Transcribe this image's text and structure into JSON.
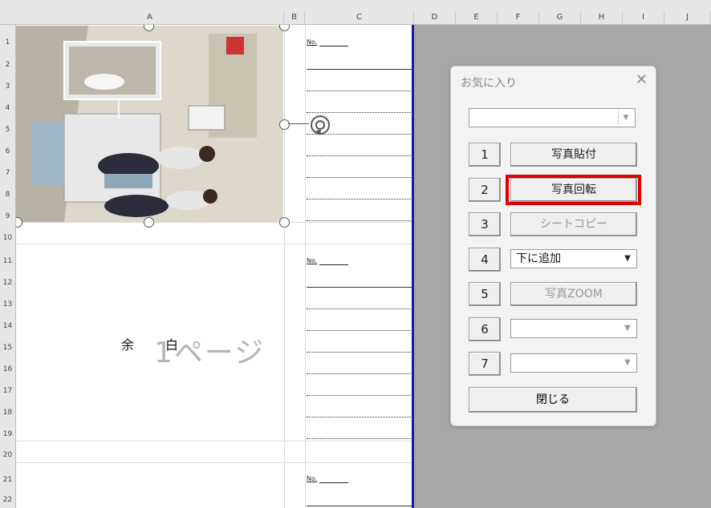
{
  "column_headers": [
    "A",
    "B",
    "C",
    "D",
    "E",
    "F",
    "G",
    "H",
    "I",
    "J"
  ],
  "row_numbers": [
    "1",
    "2",
    "3",
    "4",
    "5",
    "6",
    "7",
    "8",
    "9",
    "10",
    "11",
    "12",
    "13",
    "14",
    "15",
    "16",
    "17",
    "18",
    "19",
    "20",
    "21",
    "22"
  ],
  "sheet": {
    "no_label": "No.",
    "blank_left": "余",
    "blank_right": "白",
    "page_watermark": "1ページ"
  },
  "dialog": {
    "title": "お気に入り",
    "close_glyph": "✕",
    "buttons": [
      {
        "num": "1",
        "label": "写真貼付"
      },
      {
        "num": "2",
        "label": "写真回転"
      },
      {
        "num": "3",
        "label": "シートコピー"
      },
      {
        "num": "4",
        "label": "下に追加"
      },
      {
        "num": "5",
        "label": "写真ZOOM"
      },
      {
        "num": "6",
        "label": ""
      },
      {
        "num": "7",
        "label": ""
      }
    ],
    "close_label": "閉じる",
    "dropdown_arrow": "▼"
  },
  "icons": {
    "rotate_handle": "rotate-icon",
    "dropdown": "chevron-down-icon"
  },
  "colors": {
    "highlight": "#e00000",
    "print_border": "#1a1aa8"
  }
}
